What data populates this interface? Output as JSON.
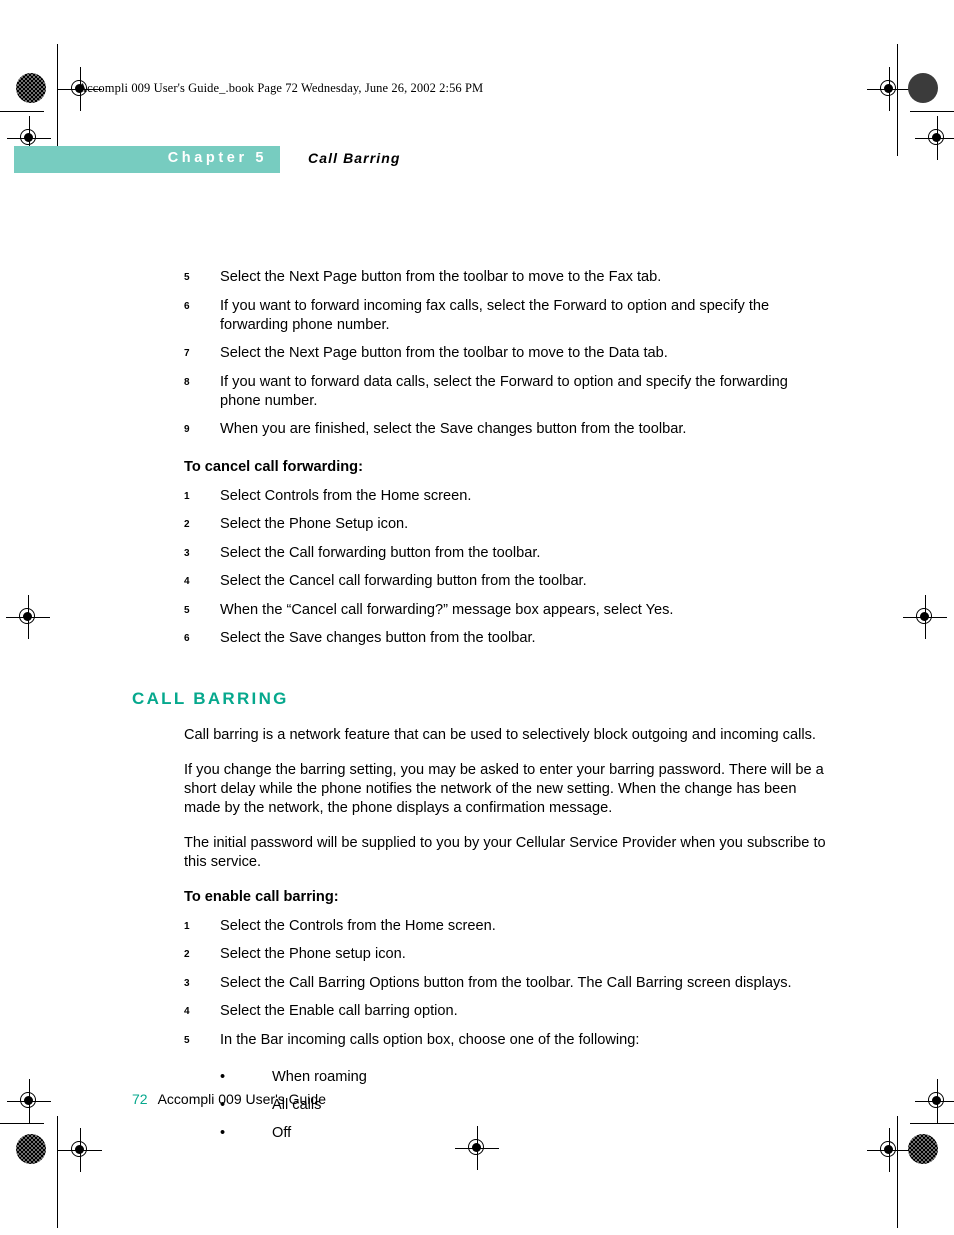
{
  "doc_header": "Accompli 009 User's Guide_.book  Page 72  Wednesday, June 26, 2002  2:56 PM",
  "chapter": {
    "banner_label": "Chapter 5",
    "topic": "Call Barring"
  },
  "forwarding_steps_continued": [
    {
      "num": "5",
      "text": "Select the Next Page button from the toolbar to move to the Fax tab."
    },
    {
      "num": "6",
      "text": "If you want to forward incoming fax calls, select the Forward to option and specify the forwarding phone number."
    },
    {
      "num": "7",
      "text": "Select the Next Page button from the toolbar to move to the Data tab."
    },
    {
      "num": "8",
      "text": "If you want to forward data calls, select the Forward to option and specify the forwarding phone number."
    },
    {
      "num": "9",
      "text": "When you are finished, select the Save changes button from the toolbar."
    }
  ],
  "cancel_forwarding": {
    "heading": "To cancel call forwarding:",
    "steps": [
      {
        "num": "1",
        "text": "Select Controls from the Home screen."
      },
      {
        "num": "2",
        "text": "Select the Phone Setup icon."
      },
      {
        "num": "3",
        "text": "Select the Call forwarding button from the toolbar."
      },
      {
        "num": "4",
        "text": "Select the Cancel call forwarding button from the toolbar."
      },
      {
        "num": "5",
        "text": "When the “Cancel call forwarding?” message box appears, select Yes."
      },
      {
        "num": "6",
        "text": "Select the Save changes button from the toolbar."
      }
    ]
  },
  "call_barring": {
    "heading": "CALL BARRING",
    "paragraphs": [
      "Call barring is a network feature that can be used to selectively block outgoing and incoming calls.",
      "If you change the barring setting, you may be asked to enter your barring password. There will be a short delay while the phone notifies the network of the new setting. When the change has been made by the network, the phone displays a confirmation message.",
      "The initial password will be supplied to you by your Cellular Service Provider when you subscribe to this service."
    ]
  },
  "enable_barring": {
    "heading": "To enable call barring:",
    "steps": [
      {
        "num": "1",
        "text": "Select the Controls from the Home screen."
      },
      {
        "num": "2",
        "text": "Select the Phone setup icon."
      },
      {
        "num": "3",
        "text": "Select the Call Barring Options button from the toolbar. The Call Barring screen displays."
      },
      {
        "num": "4",
        "text": "Select the Enable call barring option."
      },
      {
        "num": "5",
        "text": "In the Bar incoming calls option box, choose one of the following:"
      }
    ],
    "options": [
      {
        "bullet": "•",
        "text": "When roaming"
      },
      {
        "bullet": "•",
        "text": "All calls"
      },
      {
        "bullet": "•",
        "text": "Off"
      }
    ]
  },
  "footer": {
    "page_number": "72",
    "guide_title": "Accompli 009 User's Guide"
  },
  "colors": {
    "banner_teal": "#77ccc0",
    "heading_teal": "#06a88d"
  }
}
